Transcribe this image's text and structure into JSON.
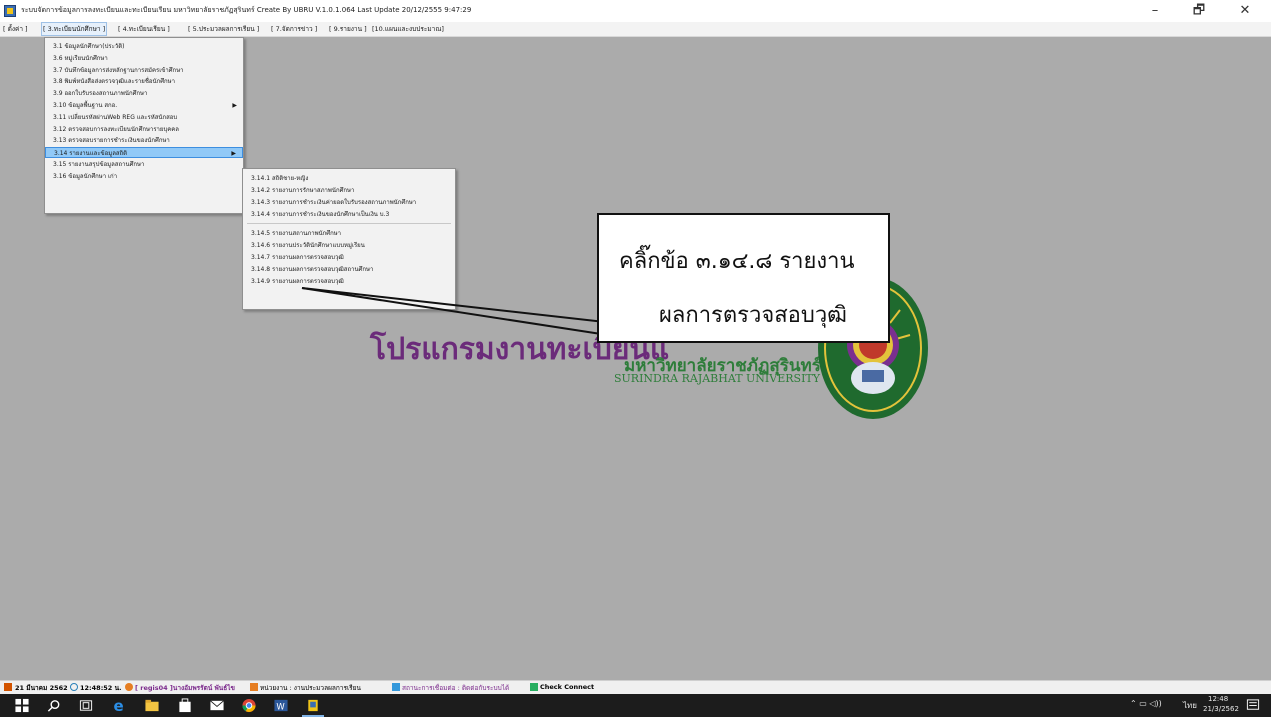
{
  "window": {
    "title": "ระบบจัดการข้อมูลการลงทะเบียนและทะเบียนเรียน มหาวิทยาลัยราชภัฏสุรินทร์ Create By UBRU   V.1.0.1.064 Last Update 20/12/2555 9:47:29",
    "min": "–",
    "max": "🗗",
    "close": "✕"
  },
  "menubar": [
    "[ ตั้งค่า ]",
    "[ 3.ทะเบียนนักศึกษา ]",
    "[ 4.ทะเบียนเรียน ]",
    "[ 5.ประมวลผลการเรียน ]",
    "[ 7.จัดการข่าว ]",
    "[ 9.รายงาน ]",
    "[10.แผนและงบประมาณ]"
  ],
  "menu_main": [
    "3.1 ข้อมูลนักศึกษา(ประวัติ)",
    "3.6 หมู่เรียนนักศึกษา",
    "3.7 บันทึกข้อมูลการส่งหลักฐานการสมัครเข้าศึกษา",
    "3.8 พิมพ์หนังสือส่งตรวจวุฒิและรายชื่อนักศึกษา",
    "3.9 ออกใบรับรองสถานภาพนักศึกษา",
    "3.10 ข้อมูลพื้นฐาน สกอ.",
    "3.11 เปลี่ยนรหัสผ่านWeb REG และรหัสนักสอบ",
    "3.12 ตรวจสอบการลงทะเบียนนักศึกษารายบุคคล",
    "3.13 ตรวจสอบรายการชำระเงินของนักศึกษา",
    "3.14 รายงานและข้อมูลสถิติ",
    "3.15 รายงานสรุปข้อมูลสถานศึกษา",
    "3.16 ข้อมูลนักศึกษา เก่า"
  ],
  "menu_main_arrows": [
    5,
    9
  ],
  "menu_main_selected": 9,
  "menu_sub": [
    "3.14.1 สถิติชาย-หญิง",
    "3.14.2 รายงานการรักษาสภาพนักศึกษา",
    "3.14.3 รายงานการชำระเงินค่ายอดใบรับรองสถานภาพนักศึกษา",
    "3.14.4 รายงานการชำระเงินของนักศึกษาเป็นเงิน บ.3",
    "3.14.5 รายงานสถานภาพนักศึกษา",
    "3.14.6 รายงานประวัตินักศึกษาแบบหมู่เรียน",
    "3.14.7 รายงานผลการตรวจสอบวุฒิ",
    "3.14.8 รายงานผลการตรวจสอบวุฒิสถานศึกษา",
    "3.14.9 รายงานผลการตรวจสอบวุฒิ"
  ],
  "callout": {
    "line1": "คลิ๊กข้อ ๓.๑๔.๘ รายงาน",
    "line2": "ผลการตรวจสอบวุฒิ"
  },
  "program_title": "โปรแกรมงานทะเบียนแ",
  "university_th": "มหาวิทยาลัยราชภัฏสุรินทร์",
  "university_en": "SURINDRA RAJABHAT UNIVERSITY",
  "statusbar": {
    "date": "21 มีนาคม 2562",
    "time": "12:48:52 น.",
    "user": "[ regis04 ]นางอัมพรรัตน์ พันธ์ไข",
    "unit": "หน่วยงาน : งานประมวลผลการเรียน",
    "conn": "สถานะการเชื่อมต่อ : ติดต่อกับระบบได้",
    "check": "Check Connect"
  },
  "tray": {
    "lang": "ไทย",
    "clock": "12:48",
    "date": "21/3/2562"
  },
  "colors": {
    "desktop": "#ababab",
    "program_title": "#6b2b7a",
    "university": "#2e7d3a",
    "selected": "#91c9f7"
  }
}
